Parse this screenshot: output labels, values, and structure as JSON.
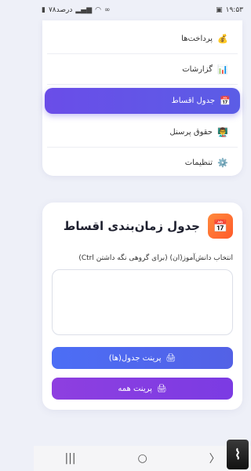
{
  "status": {
    "time": "۱۹:۵۳",
    "battery": "۷۸درصد"
  },
  "menu": {
    "items": [
      {
        "label": "پرداخت‌ها",
        "icon": "💰"
      },
      {
        "label": "گزارشات",
        "icon": "📊"
      },
      {
        "label": "جدول اقساط",
        "icon": "📅"
      },
      {
        "label": "حقوق پرسنل",
        "icon": "👨‍🏫"
      },
      {
        "label": "تنظیمات",
        "icon": "⚙️"
      }
    ]
  },
  "schedule": {
    "icon": "📅",
    "title": "جدول زمان‌بندی اقساط",
    "select_label": "انتخاب دانش‌آموز(ان) (برای گروهی نگه داشتن Ctrl)",
    "print_tables_label": "پرینت جدول(ها)",
    "print_tables_icon": "🖨",
    "print_all_label": "پرینت همه",
    "print_all_icon": "🖨"
  },
  "nav": {
    "recent": "|||",
    "home": "○",
    "back": "〉"
  }
}
